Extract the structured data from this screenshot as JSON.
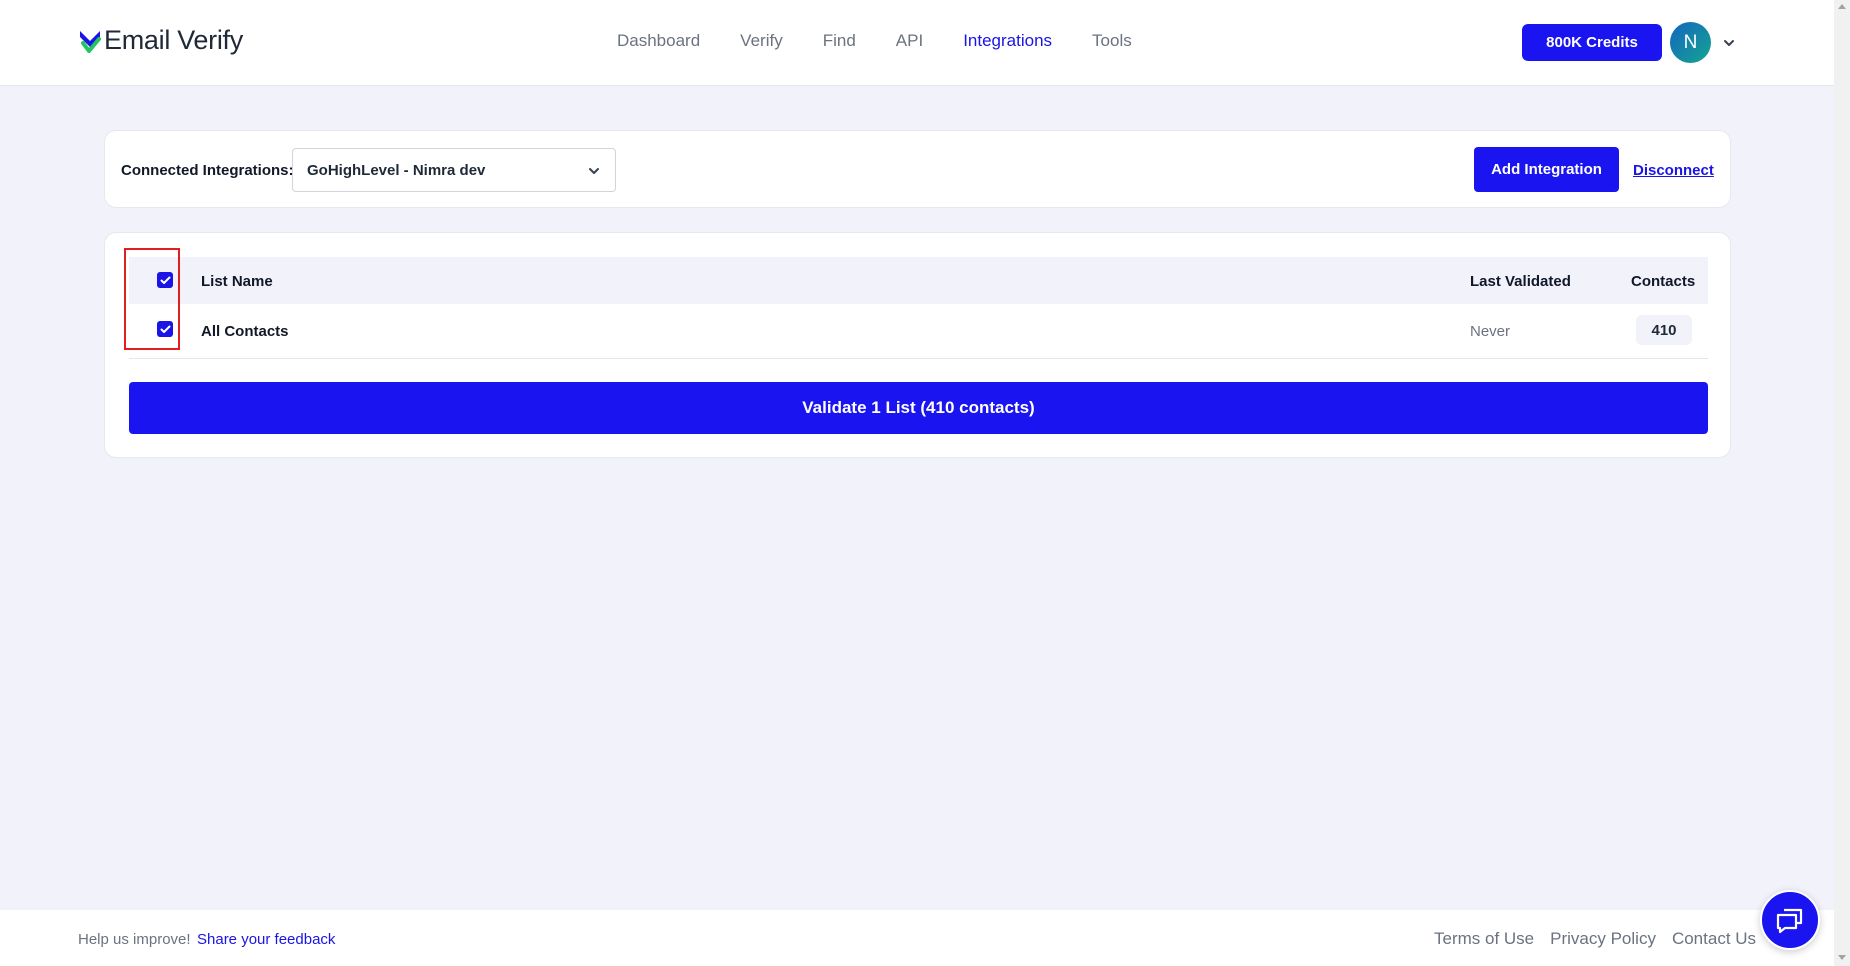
{
  "header": {
    "logo_text": "Email Verify",
    "nav": [
      {
        "label": "Dashboard",
        "active": false
      },
      {
        "label": "Verify",
        "active": false
      },
      {
        "label": "Find",
        "active": false
      },
      {
        "label": "API",
        "active": false
      },
      {
        "label": "Integrations",
        "active": true
      },
      {
        "label": "Tools",
        "active": false
      }
    ],
    "credits_label": "800K Credits",
    "avatar_initial": "N"
  },
  "integrations": {
    "label": "Connected Integrations:",
    "selected": "GoHighLevel - Nimra dev",
    "add_label": "Add Integration",
    "disconnect_label": "Disconnect"
  },
  "table": {
    "headers": {
      "list_name": "List Name",
      "last_validated": "Last Validated",
      "contacts": "Contacts"
    },
    "select_all_checked": true,
    "rows": [
      {
        "checked": true,
        "name": "All Contacts",
        "last_validated": "Never",
        "contacts": "410"
      }
    ]
  },
  "validate_label": "Validate 1 List (410 contacts)",
  "footer": {
    "help_text": "Help us improve!",
    "feedback_link": "Share your feedback",
    "links": [
      "Terms of Use",
      "Privacy Policy",
      "Contact Us"
    ]
  },
  "colors": {
    "accent": "#1a14f0",
    "highlight": "#e11d1d",
    "background": "#f1f2fa"
  }
}
